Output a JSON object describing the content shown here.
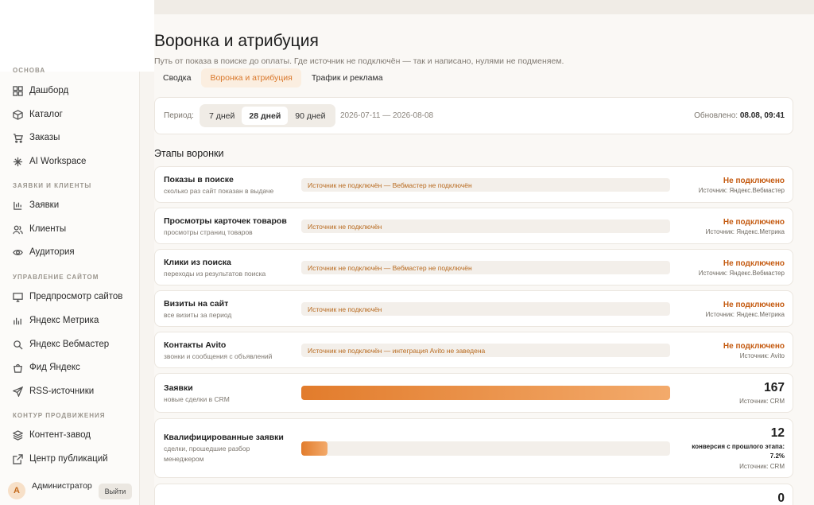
{
  "sidebar": {
    "section_main": "ОСНОВА",
    "section_requests": "ЗАЯВКИ И КЛИЕНТЫ",
    "section_site": "УПРАВЛЕНИЕ САЙТОМ",
    "section_promo": "КОНТУР ПРОДВИЖЕНИЯ",
    "items": [
      {
        "label": "Дашборд",
        "icon": "grid-icon"
      },
      {
        "label": "Каталог",
        "icon": "box-icon"
      },
      {
        "label": "Заказы",
        "icon": "cart-icon"
      },
      {
        "label": "AI Workspace",
        "icon": "sparkle-icon"
      },
      {
        "label": "Заявки",
        "icon": "inbox-icon"
      },
      {
        "label": "Клиенты",
        "icon": "users-icon"
      },
      {
        "label": "Аудитория",
        "icon": "eye-icon"
      },
      {
        "label": "Предпросмотр сайтов",
        "icon": "monitor-icon"
      },
      {
        "label": "Яндекс Метрика",
        "icon": "chart-icon"
      },
      {
        "label": "Яндекс Вебмастер",
        "icon": "search-icon"
      },
      {
        "label": "Фид Яндекс",
        "icon": "bag-icon"
      },
      {
        "label": "RSS-источники",
        "icon": "send-icon"
      },
      {
        "label": "Контент-завод",
        "icon": "layers-icon"
      },
      {
        "label": "Центр публикаций",
        "icon": "external-link-icon"
      }
    ],
    "user": {
      "initial": "А",
      "name": "Администратор",
      "logout": "Выйти"
    }
  },
  "page": {
    "title": "Воронка и атрибуция",
    "subtitle": "Путь от показа в поиске до оплаты. Где источник не подключён — так и написано, нулями не подменяем.",
    "tabs": [
      {
        "label": "Сводка",
        "active": false
      },
      {
        "label": "Воронка и атрибуция",
        "active": true
      },
      {
        "label": "Трафик и реклама",
        "active": false
      }
    ]
  },
  "period": {
    "label": "Период:",
    "options": [
      {
        "label": "7 дней",
        "active": false
      },
      {
        "label": "28 дней",
        "active": true
      },
      {
        "label": "90 дней",
        "active": false
      }
    ],
    "range": "2026-07-11 — 2026-08-08",
    "updated_label": "Обновлено:",
    "updated_value": "08.08, 09:41"
  },
  "stages_title": "Этапы воронки",
  "stages": [
    {
      "name": "Показы в поиске",
      "desc": "сколько раз сайт показан в выдаче",
      "note": "Источник не подключён — Вебмастер не подключён",
      "status": "Не подключено",
      "source": "Источник: Яндекс.Вебмастер"
    },
    {
      "name": "Просмотры карточек товаров",
      "desc": "просмотры страниц товаров",
      "note": "Источник не подключён",
      "status": "Не подключено",
      "source": "Источник: Яндекс.Метрика"
    },
    {
      "name": "Клики из поиска",
      "desc": "переходы из результатов поиска",
      "note": "Источник не подключён — Вебмастер не подключён",
      "status": "Не подключено",
      "source": "Источник: Яндекс.Вебмастер"
    },
    {
      "name": "Визиты на сайт",
      "desc": "все визиты за период",
      "note": "Источник не подключён",
      "status": "Не подключено",
      "source": "Источник: Яндекс.Метрика"
    },
    {
      "name": "Контакты Avito",
      "desc": "звонки и сообщения с объявлений",
      "note": "Источник не подключён — интеграция Avito не заведена",
      "status": "Не подключено",
      "source": "Источник: Avito"
    },
    {
      "name": "Заявки",
      "desc": "новые сделки в CRM",
      "value": "167",
      "fill": 1.0,
      "source": "Источник: CRM"
    },
    {
      "name": "Квалифицированные заявки",
      "desc": "сделки, прошедшие разбор менеджером",
      "value": "12",
      "fill": 0.072,
      "conversion": "конверсия с прошлого этапа: 7.2%",
      "source": "Источник: CRM"
    },
    {
      "value": "0"
    }
  ]
}
